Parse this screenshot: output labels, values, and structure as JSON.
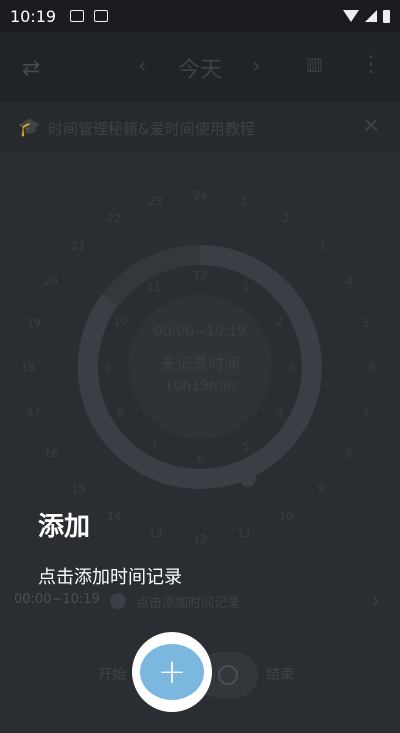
{
  "status_bar": {
    "time": "10:19",
    "icons": [
      "image-icon",
      "a-badge-icon",
      "wifi-icon",
      "signal-icon",
      "battery-icon"
    ]
  },
  "app_bar": {
    "menu_icon": "swap-arrows-icon",
    "prev_icon": "chevron-left-icon",
    "title": "今天",
    "next_icon": "chevron-right-icon",
    "stats_icon": "bar-chart-icon",
    "more_icon": "more-vertical-icon"
  },
  "banner": {
    "icon": "graduation-cap-icon",
    "text": "时间管理秘籍&爱时间使用教程",
    "close_icon": "close-icon"
  },
  "clock": {
    "hour_labels": [
      "24",
      "1",
      "2",
      "3",
      "4",
      "5",
      "6",
      "7",
      "8",
      "9",
      "10",
      "11",
      "12",
      "13",
      "14",
      "15",
      "16",
      "17",
      "18",
      "19",
      "20",
      "21",
      "22",
      "23"
    ],
    "inner_labels": [
      "12",
      "1",
      "2",
      "3",
      "4",
      "5",
      "6",
      "7",
      "8",
      "9",
      "10",
      "11"
    ],
    "center_line1": "00:00~10:19",
    "center_line2": "未记录时间",
    "center_line3": "10h19min"
  },
  "record": {
    "time_range": "00:00~10:19",
    "label": "点击添加时间记录",
    "arrow_icon": "chevron-right-icon"
  },
  "bottom_bar": {
    "start_label": "开始",
    "end_label": "结束",
    "timer_icon": "clock-icon"
  },
  "tutorial": {
    "title": "添加",
    "description": "点击添加时间记录",
    "fab_icon": "plus-icon",
    "fab_symbol": "+"
  },
  "colors": {
    "fab": "#7cb7e0",
    "overlay_background": "#2a2e33"
  }
}
